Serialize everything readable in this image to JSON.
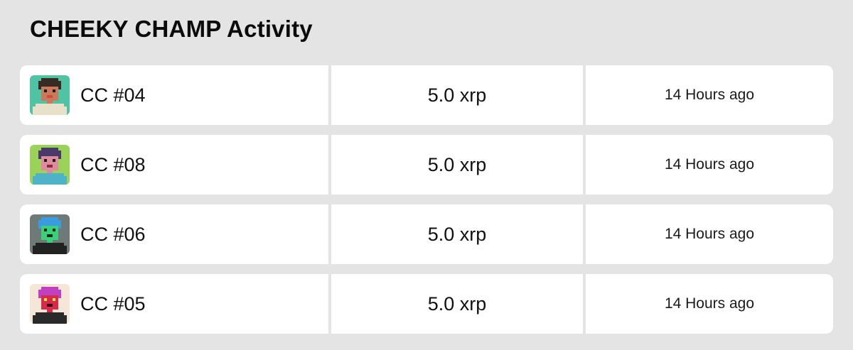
{
  "header": {
    "title": "CHEEKY CHAMP Activity"
  },
  "activity": [
    {
      "name": "CC #04",
      "price": "5.0 xrp",
      "time": "14 Hours ago",
      "avatar": {
        "bg": "#4fc3a3",
        "skin": "#c97a5a",
        "hair": "#3a2a24",
        "accent": "#e8e0c8",
        "eyes": "#1a1a1a",
        "mouth": "#d24a3a"
      }
    },
    {
      "name": "CC #08",
      "price": "5.0 xrp",
      "time": "14 Hours ago",
      "avatar": {
        "bg": "#9bd25a",
        "skin": "#e08aa0",
        "hair": "#4a3a6a",
        "accent": "#4fb3c8",
        "eyes": "#1a1a1a",
        "mouth": "#8a2a3a"
      }
    },
    {
      "name": "CC #06",
      "price": "5.0 xrp",
      "time": "14 Hours ago",
      "avatar": {
        "bg": "#6f7a78",
        "skin": "#3bd17a",
        "hair": "#3a9be0",
        "accent": "#222222",
        "eyes": "#0d2a1a",
        "mouth": "#0d2a1a"
      }
    },
    {
      "name": "CC #05",
      "price": "5.0 xrp",
      "time": "14 Hours ago",
      "avatar": {
        "bg": "#f6e6d8",
        "skin": "#d62a4a",
        "hair": "#c040c0",
        "accent": "#2a2a2a",
        "eyes": "#f4e04a",
        "mouth": "#3a0a14"
      }
    }
  ]
}
